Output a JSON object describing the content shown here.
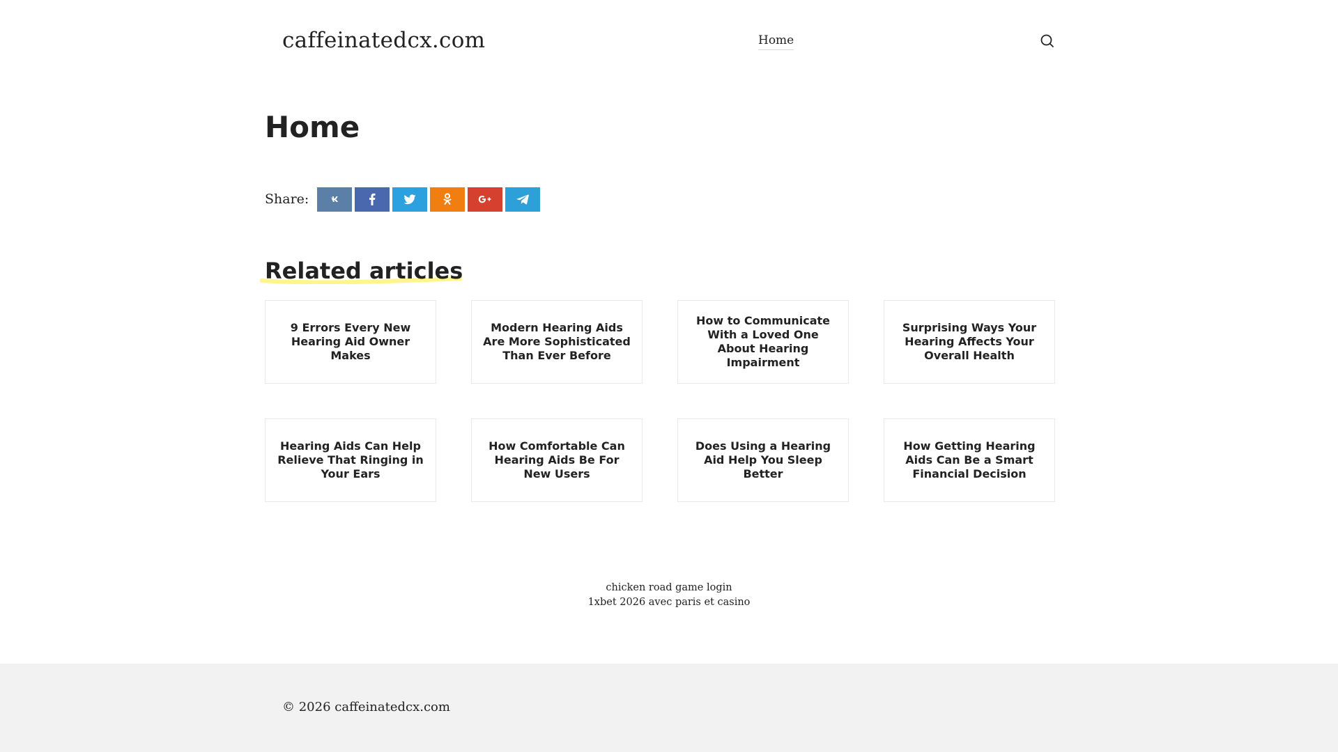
{
  "header": {
    "site_title": "caffeinatedcx.com",
    "nav": [
      {
        "label": "Home"
      }
    ],
    "search_icon": "search-icon"
  },
  "main": {
    "title": "Home",
    "share": {
      "label": "Share:",
      "buttons": [
        {
          "name": "vk",
          "icon": "vk-icon",
          "color": "#5b7fa6"
        },
        {
          "name": "facebook",
          "icon": "facebook-icon",
          "color": "#4a68ad"
        },
        {
          "name": "twitter",
          "icon": "twitter-icon",
          "color": "#2da1e0"
        },
        {
          "name": "odnoklassniki",
          "icon": "odnoklassniki-icon",
          "color": "#f07e10"
        },
        {
          "name": "google-plus",
          "icon": "google-plus-icon",
          "color": "#d6412f"
        },
        {
          "name": "telegram",
          "icon": "telegram-icon",
          "color": "#2d9fd9"
        }
      ]
    },
    "related": {
      "title": "Related articles",
      "underline_color": "#fff58a",
      "articles": [
        {
          "title": "9 Errors Every New Hearing Aid Owner Makes"
        },
        {
          "title": "Modern Hearing Aids Are More Sophisticated Than Ever Before"
        },
        {
          "title": "How to Communicate With a Loved One About Hearing Impairment"
        },
        {
          "title": "Surprising Ways Your Hearing Affects Your Overall Health"
        },
        {
          "title": "Hearing Aids Can Help Relieve That Ringing in Your Ears"
        },
        {
          "title": "How Comfortable Can Hearing Aids Be For New Users"
        },
        {
          "title": "Does Using a Hearing Aid Help You Sleep Better"
        },
        {
          "title": "How Getting Hearing Aids Can Be a Smart Financial Decision"
        }
      ]
    }
  },
  "footer_links": [
    {
      "label": "chicken road game login"
    },
    {
      "label": "1xbet 2026 avec paris et casino"
    }
  ],
  "footer": {
    "copyright": "© 2026 caffeinatedcx.com",
    "background": "#f2f2f2"
  }
}
